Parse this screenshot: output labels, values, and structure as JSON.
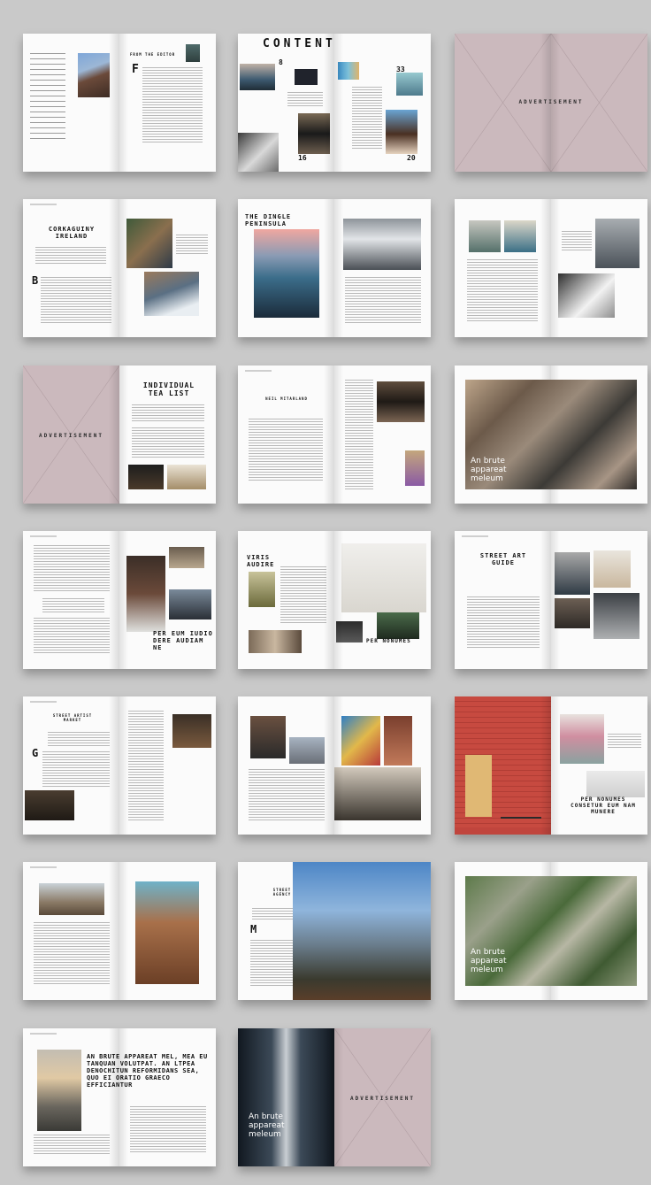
{
  "spreads": {
    "contents_title": "CONTENTS",
    "contents_numbers": [
      "8",
      "16",
      "20",
      "33"
    ],
    "editor_heading": "FROM THE EDITOR",
    "advertisement": "ADVERTISEMENT",
    "corkaguiny": "CORKAGUINY IRELAND",
    "dingle": "THE DINGLE PENINSULA",
    "tea_list": "INDIVIDUAL TEA LIST",
    "neil": "NEIL MITARLAND",
    "brute_short": "An brute appareat meleum",
    "per_eum": "PER EUM IUDIO DERE AUDIAM NE",
    "viris": "VIRIS AUDIRE",
    "per_nonumes_short": "PER NONUMES",
    "street_art": "STREET ART GUIDE",
    "street_artist": "STREET ARTIST MARKET",
    "per_nonumes_long": "PER NONUMES CONSETUR EUM NAM MUNERE",
    "street_agency": "STREET AGENCY",
    "long_quote": "AN BRUTE APPAREAT MEL, MEA EU TANQUAN VOLUTPAT. AN LTPEA DENOCHITUN REFORMIDANS SEA, QUO EI ORATIO GRAECO EFFICIANTUR"
  },
  "colors": {
    "background": "#c9c9c9",
    "page": "#fbfbfb",
    "mauve": "#cbb9bd"
  }
}
